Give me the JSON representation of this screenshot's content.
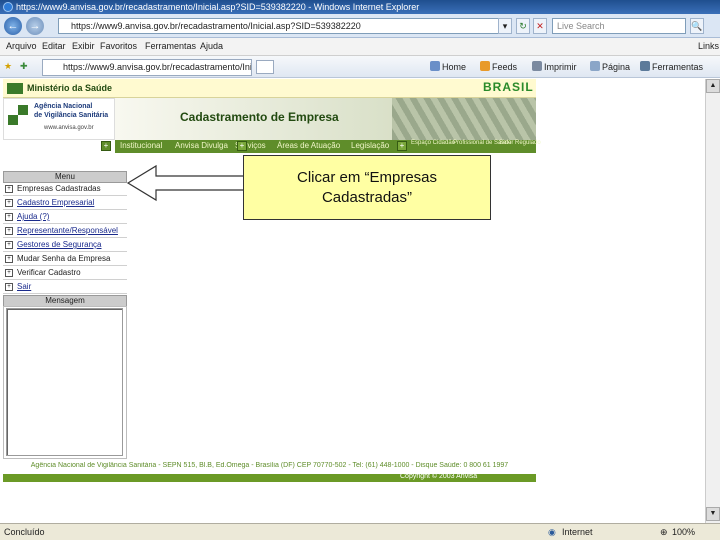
{
  "window": {
    "title": "https://www9.anvisa.gov.br/recadastramento/Inicial.asp?SID=539382220 - Windows Internet Explorer"
  },
  "address_bar": {
    "url": "https://www9.anvisa.gov.br/recadastramento/Inicial.asp?SID=539382220",
    "search_placeholder": "Live Search",
    "back_glyph": "←",
    "forward_glyph": "→",
    "refresh_glyph": "↻",
    "stop_glyph": "✕",
    "go_glyph": "▾",
    "search_glyph": "🔍"
  },
  "menu_bar": {
    "items": [
      "Arquivo",
      "Editar",
      "Exibir",
      "Favoritos",
      "Ferramentas",
      "Ajuda"
    ],
    "links_label": "Links"
  },
  "command_bar": {
    "tab_title": "https://www9.anvisa.gov.br/recadastramento/Inicia...",
    "home": "Home",
    "feeds": "Feeds",
    "print": "Imprimir",
    "page": "Página",
    "tools": "Ferramentas"
  },
  "page": {
    "ministry": "Ministério da Saúde",
    "agency_name_line1": "Agência Nacional",
    "agency_name_line2": "de Vigilância Sanitária",
    "agency_url": "www.anvisa.gov.br",
    "banner_title": "Cadastramento de Empresa",
    "brasil_logo": "BRASIL",
    "nav_items": [
      "Institucional",
      "Anvisa Divulga",
      "Serviços",
      "Áreas de Atuação",
      "Legislação"
    ],
    "side_links": [
      "Espaço Cidadão",
      "Profissional de Saúde",
      "Setor Regulado"
    ],
    "menu_title": "Menu",
    "menu_items": [
      {
        "label": "Empresas Cadastradas",
        "link": false
      },
      {
        "label": "Cadastro Empresarial",
        "link": true
      },
      {
        "label": "Ajuda (?)",
        "link": true
      },
      {
        "label": "Representante/Responsável",
        "link": true
      },
      {
        "label": "Gestores de Segurança",
        "link": true
      },
      {
        "label": "Mudar Senha da Empresa",
        "link": false
      },
      {
        "label": "Verificar Cadastro",
        "link": false
      },
      {
        "label": "Sair",
        "link": true
      }
    ],
    "message_title": "Mensagem",
    "callout_line1": "Clicar em “Empresas",
    "callout_line2": "Cadastradas”",
    "footer": "Agência Nacional de Vigilância Sanitária - SEPN 515, Bl.B, Ed.Ômega - Brasília (DF) CEP 70770-502 - Tel: (61) 448-1000 - Disque Saúde: 0 800 61 1997",
    "copyright": "Copyright © 2003 Anvisa"
  },
  "status_bar": {
    "left": "Concluído",
    "zone": "Internet",
    "zoom": "100%"
  },
  "colors": {
    "anvisa_green": "#5f8d2a",
    "callout_yellow": "#ffffa3",
    "header_yellow": "#fffad0",
    "link_blue": "#1a2a8c"
  }
}
